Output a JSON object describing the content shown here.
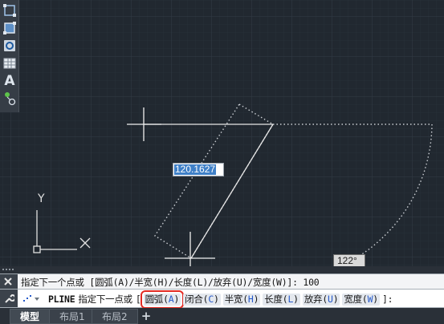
{
  "drawing": {
    "dynamic_input_value": "120.1627",
    "angle_tooltip": "122°",
    "ucs_axis_y": "Y",
    "ucs_axis_x": "X"
  },
  "toolbar": {
    "tools": [
      {
        "name": "select-window-icon"
      },
      {
        "name": "crossing-window-icon"
      },
      {
        "name": "region-icon"
      },
      {
        "name": "table-icon"
      },
      {
        "name": "text-tool",
        "label": "A"
      },
      {
        "name": "node-tool-icon"
      }
    ]
  },
  "command": {
    "history_line": "指定下一个点或 [圆弧(A)/半宽(H)/长度(L)/放弃(U)/宽度(W)]: 100",
    "command_name": "PLINE",
    "prompt": "指定下一点或",
    "bracket_open": "[",
    "bracket_close": "]:",
    "options": [
      {
        "label": "圆弧",
        "key": "A",
        "selected": true
      },
      {
        "label": "闭合",
        "key": "C",
        "selected": false
      },
      {
        "label": "半宽",
        "key": "H",
        "selected": false
      },
      {
        "label": "长度",
        "key": "L",
        "selected": false
      },
      {
        "label": "放弃",
        "key": "U",
        "selected": false
      },
      {
        "label": "宽度",
        "key": "W",
        "selected": false
      }
    ]
  },
  "tabs": {
    "items": [
      {
        "label": "模型",
        "active": true
      },
      {
        "label": "布局1",
        "active": false
      },
      {
        "label": "布局2",
        "active": false
      }
    ],
    "add_label": "+"
  },
  "colors": {
    "canvas_bg": "#212830",
    "grid_minor": "#283039",
    "grid_major": "#323b46",
    "geometry": "#e6e6e6",
    "selection_highlight": "#e32a22",
    "dynamic_input_highlight": "#3f80c8"
  }
}
